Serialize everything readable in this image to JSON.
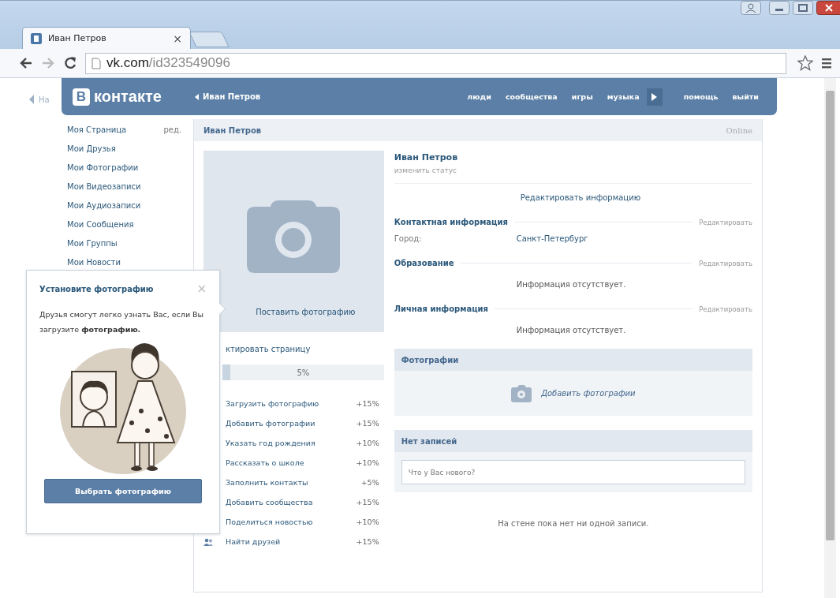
{
  "browser": {
    "tab": {
      "title": "Иван Петров",
      "close": "×"
    },
    "address": {
      "host": "vk.com",
      "path": "/id323549096"
    }
  },
  "back_link": "На",
  "header": {
    "logo_letter": "В",
    "logo": "контакте",
    "back": "Иван Петров",
    "nav": [
      {
        "kind": "link",
        "label": "люди"
      },
      {
        "kind": "link",
        "label": "сообщества"
      },
      {
        "kind": "link",
        "label": "игры"
      },
      {
        "kind": "link",
        "label": "музыка"
      },
      {
        "kind": "player"
      },
      {
        "kind": "link",
        "label": "помощь"
      },
      {
        "kind": "link",
        "label": "выйти"
      }
    ]
  },
  "sidebar": {
    "items": [
      {
        "label": "Моя Страница",
        "extra": "ред."
      },
      {
        "label": "Мои Друзья"
      },
      {
        "label": "Мои Фотографии"
      },
      {
        "label": "Мои Видеозаписи"
      },
      {
        "label": "Мои Аудиозаписи"
      },
      {
        "label": "Мои Сообщения"
      },
      {
        "label": "Мои Группы"
      },
      {
        "label": "Мои Новости"
      }
    ]
  },
  "profile": {
    "title": "Иван Петров",
    "online": "Online",
    "photo_caption": "Поставить фотографию",
    "edit_page": "ктировать страницу",
    "completion": {
      "level": 0.05,
      "reading": "5%"
    },
    "tasks": [
      {
        "kind": "task",
        "label": "Загрузить фотографию",
        "bonus": "+15%"
      },
      {
        "kind": "task",
        "label": "Добавить фотографии",
        "bonus": "+15%"
      },
      {
        "kind": "task",
        "label": "Указать год рождения",
        "bonus": "+10%"
      },
      {
        "kind": "task",
        "label": "Рассказать о школе",
        "bonus": "+10%"
      },
      {
        "kind": "task",
        "label": "Заполнить контакты",
        "bonus": "+5%"
      },
      {
        "kind": "task",
        "label": "Добавить сообщества",
        "bonus": "+15%"
      },
      {
        "kind": "task",
        "label": "Поделиться новостью",
        "bonus": "+10%"
      },
      {
        "kind": "friends",
        "label": "Найти друзей",
        "bonus": "+15%"
      }
    ]
  },
  "info": {
    "name": "Иван Петров",
    "status": "изменить статус",
    "edit_info": "Редактировать информацию",
    "sections": [
      {
        "title": "Контактная информация",
        "edit": "Редактировать",
        "rows": [
          {
            "label": "Город:",
            "value": "Санкт-Петербург"
          }
        ]
      },
      {
        "title": "Образование",
        "edit": "Редактировать",
        "empty": "Информация отсутствует."
      },
      {
        "title": "Личная информация",
        "edit": "Редактировать",
        "empty": "Информация отсутствует."
      }
    ]
  },
  "photos": {
    "title": "Фотографии",
    "add": "Добавить фотографии"
  },
  "wall": {
    "title": "Нет записей",
    "placeholder": "Что у Вас нового?",
    "empty": "На стене пока нет ни одной записи."
  },
  "popup": {
    "title": "Установите фотографию",
    "close": "×",
    "text": "Друзья смогут легко узнать Вас, если Вы загрузите **фотографию.**",
    "button": "Выбрать фотографию"
  }
}
